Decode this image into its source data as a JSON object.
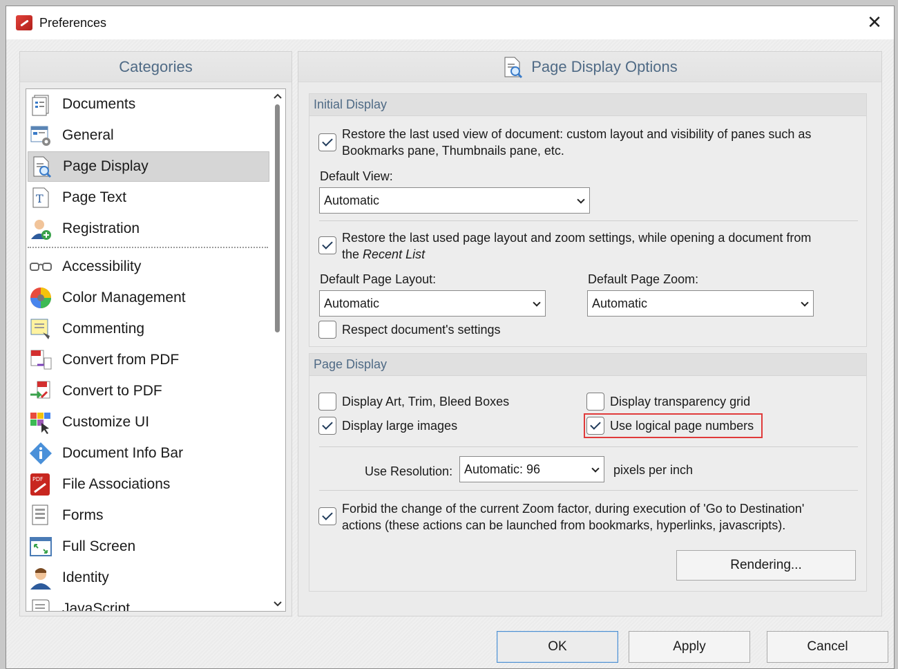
{
  "window": {
    "title": "Preferences",
    "close_label": "✕"
  },
  "left": {
    "header": "Categories",
    "items": [
      {
        "label": "Documents",
        "icon": "documents-icon"
      },
      {
        "label": "General",
        "icon": "general-settings-icon"
      },
      {
        "label": "Page Display",
        "icon": "page-display-icon",
        "selected": true
      },
      {
        "label": "Page Text",
        "icon": "page-text-icon"
      },
      {
        "label": "Registration",
        "icon": "registration-icon"
      },
      {
        "label": "Accessibility",
        "icon": "glasses-icon"
      },
      {
        "label": "Color Management",
        "icon": "color-wheel-icon"
      },
      {
        "label": "Commenting",
        "icon": "commenting-icon"
      },
      {
        "label": "Convert from PDF",
        "icon": "convert-from-pdf-icon"
      },
      {
        "label": "Convert to PDF",
        "icon": "convert-to-pdf-icon"
      },
      {
        "label": "Customize UI",
        "icon": "customize-ui-icon"
      },
      {
        "label": "Document Info Bar",
        "icon": "info-icon"
      },
      {
        "label": "File Associations",
        "icon": "pdf-file-icon"
      },
      {
        "label": "Forms",
        "icon": "forms-icon"
      },
      {
        "label": "Full Screen",
        "icon": "full-screen-icon"
      },
      {
        "label": "Identity",
        "icon": "identity-icon"
      },
      {
        "label": "JavaScript",
        "icon": "javascript-icon"
      }
    ]
  },
  "right": {
    "header": "Page Display Options",
    "initial_display": {
      "title": "Initial Display",
      "restore_view_line1": "Restore the last used view of document: custom layout and visibility of panes such as",
      "restore_view_line2": "Bookmarks pane, Thumbnails pane, etc.",
      "default_view_label": "Default View:",
      "default_view_value": "Automatic",
      "restore_layout_line1": "Restore the last used page layout and zoom settings, while opening a document from",
      "restore_layout_line2_a": "the ",
      "restore_layout_line2_b": "Recent List",
      "default_layout_label": "Default Page Layout:",
      "default_layout_value": "Automatic",
      "default_zoom_label": "Default Page Zoom:",
      "default_zoom_value": "Automatic",
      "respect_settings": "Respect document's settings"
    },
    "page_display": {
      "title": "Page Display",
      "display_art": "Display Art, Trim, Bleed Boxes",
      "display_transparency": "Display transparency grid",
      "display_large_images": "Display large images",
      "use_logical_numbers": "Use logical page numbers",
      "use_resolution_label": "Use Resolution:",
      "resolution_value": "Automatic: 96",
      "pixels_per_inch": "pixels per inch",
      "forbid_zoom_line1": "Forbid the change of the current Zoom factor, during execution of 'Go to Destination'",
      "forbid_zoom_line2": "actions (these actions can be launched from bookmarks, hyperlinks, javascripts).",
      "rendering_button": "Rendering..."
    }
  },
  "footer": {
    "ok": "OK",
    "apply": "Apply",
    "cancel": "Cancel"
  },
  "checks": {
    "restore_view": true,
    "restore_layout": true,
    "respect_settings": false,
    "display_art": false,
    "display_transparency": false,
    "display_large_images": true,
    "use_logical_numbers": true,
    "forbid_zoom": true
  },
  "colors": {
    "accent_header": "#4f6a85",
    "highlight": "#e03a3a",
    "app_icon": "#c8261f"
  }
}
